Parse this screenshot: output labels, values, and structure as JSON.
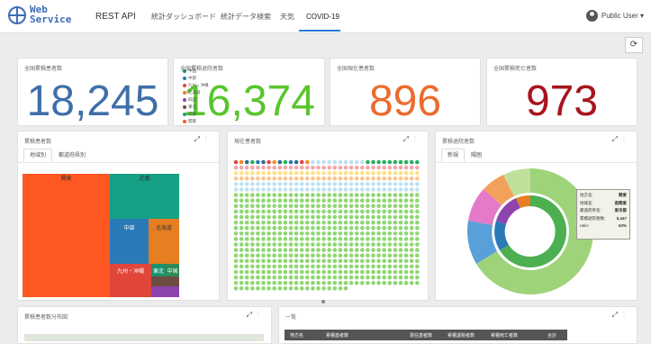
{
  "header": {
    "logo_line1": "Web",
    "logo_line2": "Service",
    "nav": [
      "REST API",
      "統計ダッシュボード",
      "統計データ検索",
      "天気",
      "COVID-19"
    ],
    "user": "Public User ▾",
    "refresh_icon": "refresh-icon"
  },
  "kpis": [
    {
      "title": "全国累積患者数",
      "value": "18,245",
      "color": "#3f6fa8"
    },
    {
      "title": "全国累積退院者数",
      "value": "16,374",
      "color": "#58c52b"
    },
    {
      "title": "全国現在患者数",
      "value": "896",
      "color": "#ec6b2d"
    },
    {
      "title": "全国累積死亡者数",
      "value": "973",
      "color": "#a8141d"
    }
  ],
  "panels": {
    "cumulative_patients": {
      "title": "累積患者数",
      "tabs": [
        "地域別",
        "都道府県別"
      ],
      "treemap_labels": [
        "関東",
        "近畿",
        "中部",
        "北海道",
        "九州・沖縄",
        "東北",
        "中国"
      ],
      "legend": [
        {
          "label": "中国",
          "color": "#1a9070"
        },
        {
          "label": "中部",
          "color": "#2a7ab8"
        },
        {
          "label": "九州・沖縄",
          "color": "#e0463a"
        },
        {
          "label": "北海道",
          "color": "#e67e22"
        },
        {
          "label": "四国",
          "color": "#8e44ad"
        },
        {
          "label": "東北",
          "color": "#6d4c41"
        },
        {
          "label": "近畿",
          "color": "#16a085"
        },
        {
          "label": "関東",
          "color": "#ff5722"
        }
      ]
    },
    "current_patients": {
      "title": "現在患者数"
    },
    "discharged": {
      "title": "累積退院者数",
      "tabs": [
        "新規",
        "陽圏"
      ],
      "tooltip": [
        {
          "k": "地方名:",
          "v": "関東"
        },
        {
          "k": "地域名:",
          "v": "南関東"
        },
        {
          "k": "都道府県名:",
          "v": "東京都"
        },
        {
          "k": "累積退院者数:",
          "v": "5,447"
        },
        {
          "k": "ratio:",
          "v": "63%"
        }
      ]
    },
    "distribution": {
      "title": "累積患者数分布図"
    },
    "list": {
      "title": "一覧",
      "columns": [
        "地方名",
        "累積患者数",
        "現在患者数",
        "累積退院者数",
        "累積死亡者数",
        "合計"
      ]
    }
  }
}
